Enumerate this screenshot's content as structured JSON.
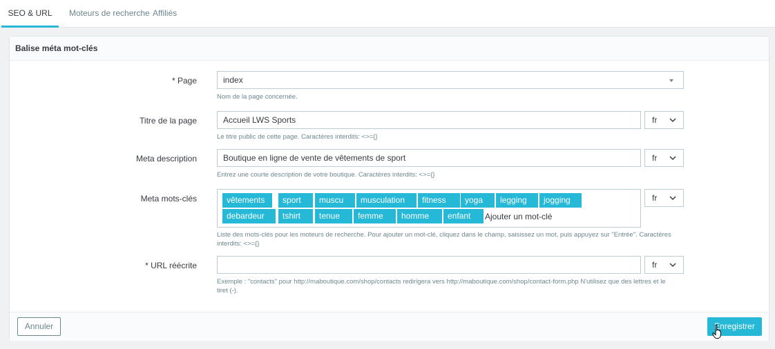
{
  "tabs": [
    {
      "label": "SEO & URL",
      "active": true
    },
    {
      "label": "Moteurs de recherche",
      "active": false
    },
    {
      "label": "Affiliés",
      "active": false
    }
  ],
  "panel": {
    "title": "Balise méta mot-clés"
  },
  "form": {
    "page": {
      "label": "* Page",
      "value": "index",
      "help": "Nom de la page concernée."
    },
    "page_title": {
      "label": "Titre de la page",
      "value": "Accueil LWS Sports",
      "lang": "fr",
      "help": "Le titre public de cette page. Caractères interdits: <>={}"
    },
    "meta_description": {
      "label": "Meta description",
      "value": "Boutique en ligne de vente de vêtements de sport",
      "lang": "fr",
      "help": "Entrez une courte description de votre boutique. Caractères interdits: <>={}"
    },
    "meta_keywords": {
      "label": "Meta mots-clés",
      "lang": "fr",
      "tags": [
        "vêtements",
        "sport",
        "muscu",
        "musculation",
        "fitness",
        "yoga",
        "legging",
        "jogging",
        "debardeur",
        "tshirt",
        "tenue",
        "femme",
        "homme",
        "enfant"
      ],
      "placeholder": "Ajouter un mot-clé",
      "help_line1": "Liste des mots-clés pour les moteurs de recherche. Pour ajouter un mot-clé, cliquez dans le champ, saisissez un mot, puis appuyez sur \"Entrée\". Caractères",
      "help_line2": "interdits: <>={}"
    },
    "rewritten_url": {
      "label": "* URL réécrite",
      "value": "",
      "lang": "fr",
      "help_line1": "Exemple : \"contacts\" pour http://maboutique.com/shop/contacts redirigera vers http://maboutique.com/shop/contact-form.php N'utilisez que des lettres et le",
      "help_line2": "tiret (-)."
    }
  },
  "footer": {
    "cancel_label": "Annuler",
    "save_label": "Enregistrer"
  },
  "colors": {
    "accent": "#25b9d7",
    "text": "#363a41",
    "muted": "#6c868e",
    "border": "#bbcdd2"
  }
}
